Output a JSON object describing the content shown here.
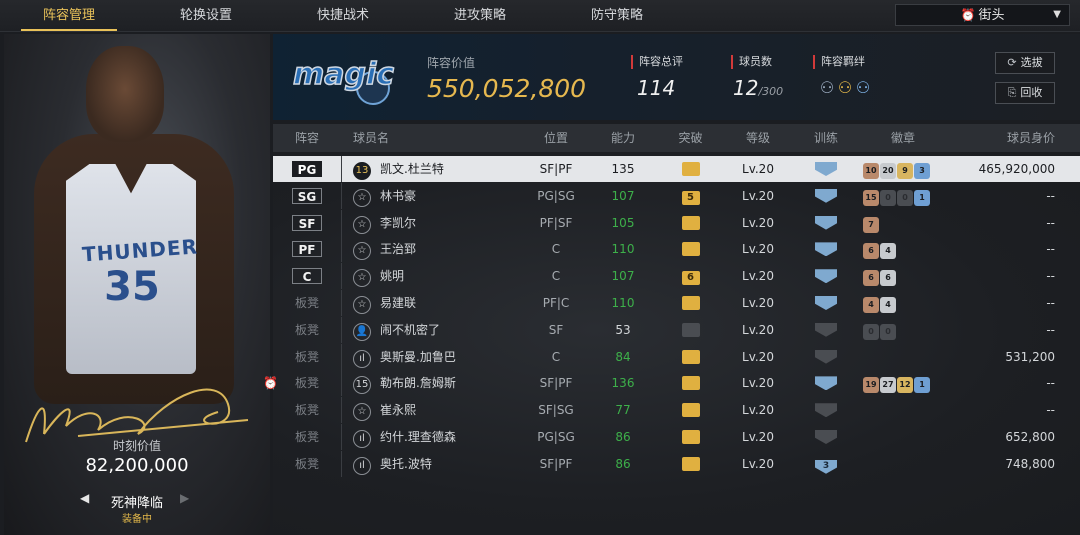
{
  "nav": {
    "tabs": [
      "阵容管理",
      "轮换设置",
      "快捷战术",
      "进攻策略",
      "防守策略"
    ],
    "region": "街头"
  },
  "card": {
    "jersey_text": "THUNDER",
    "jersey_number": "35",
    "value_label": "时刻价值",
    "value": "82,200,000",
    "skill_name": "死神降临",
    "skill_status": "装备中"
  },
  "team": {
    "logo_text": "magic",
    "value_label": "阵容价值",
    "value": "550,052,800",
    "rating_label": "阵容总评",
    "rating": "114",
    "count_label": "球员数",
    "count": "12",
    "count_max": "/300",
    "bond_label": "阵容羁绊",
    "btn_select": "选拔",
    "btn_recycle": "回收"
  },
  "columns": [
    "阵容",
    "球员名",
    "位置",
    "能力",
    "突破",
    "等级",
    "训练",
    "徽章",
    "球员身价"
  ],
  "rows": [
    {
      "slot": "PG",
      "pic": "13",
      "name": "凯文.杜兰特",
      "pos": "SF|PF",
      "ability": "135",
      "breakthrough": "",
      "level": "Lv.20",
      "train": "",
      "badges": [
        [
          "10",
          "bronze"
        ],
        [
          "20",
          "silver"
        ],
        [
          "9",
          "gold"
        ],
        [
          "3",
          "blue"
        ]
      ],
      "price": "465,920,000"
    },
    {
      "slot": "SG",
      "pic": "☆",
      "name": "林书豪",
      "pos": "PG|SG",
      "ability": "107",
      "breakthrough": "5",
      "level": "Lv.20",
      "train": "",
      "badges": [
        [
          "15",
          "bronze"
        ],
        [
          "0",
          "dark"
        ],
        [
          "0",
          "dark"
        ],
        [
          "1",
          "blue"
        ]
      ],
      "price": "--"
    },
    {
      "slot": "SF",
      "pic": "☆",
      "name": "李凯尔",
      "pos": "PF|SF",
      "ability": "105",
      "breakthrough": "",
      "level": "Lv.20",
      "train": "",
      "badges": [
        [
          "7",
          "bronze"
        ]
      ],
      "price": "--"
    },
    {
      "slot": "PF",
      "pic": "☆",
      "name": "王治郅",
      "pos": "C",
      "ability": "110",
      "breakthrough": "",
      "level": "Lv.20",
      "train": "",
      "badges": [
        [
          "6",
          "bronze"
        ],
        [
          "4",
          "silver"
        ]
      ],
      "price": "--"
    },
    {
      "slot": "C",
      "pic": "☆",
      "name": "姚明",
      "pos": "C",
      "ability": "107",
      "breakthrough": "6",
      "level": "Lv.20",
      "train": "",
      "badges": [
        [
          "6",
          "bronze"
        ],
        [
          "6",
          "silver"
        ]
      ],
      "price": "--"
    },
    {
      "slot": "板凳",
      "pic": "☆",
      "name": "易建联",
      "pos": "PF|C",
      "ability": "110",
      "breakthrough": "",
      "level": "Lv.20",
      "train": "",
      "badges": [
        [
          "4",
          "bronze"
        ],
        [
          "4",
          "silver"
        ]
      ],
      "price": "--"
    },
    {
      "slot": "板凳",
      "pic": "👤",
      "name": "闹不机密了",
      "pos": "SF",
      "ability": "53",
      "breakthrough": "",
      "level": "Lv.20",
      "train": "",
      "badges": [
        [
          "0",
          "dark"
        ],
        [
          "0",
          "dark"
        ]
      ],
      "price": "--"
    },
    {
      "slot": "板凳",
      "pic": "ıl",
      "name": "奥斯曼.加鲁巴",
      "pos": "C",
      "ability": "84",
      "breakthrough": "",
      "level": "Lv.20",
      "train": "",
      "badges": [],
      "price": "531,200"
    },
    {
      "slot": "板凳",
      "pic": "15",
      "name": "勒布朗.詹姆斯",
      "pos": "SF|PF",
      "ability": "136",
      "breakthrough": "",
      "level": "Lv.20",
      "train": "",
      "badges": [
        [
          "19",
          "bronze"
        ],
        [
          "27",
          "silver"
        ],
        [
          "12",
          "gold"
        ],
        [
          "1",
          "blue"
        ]
      ],
      "price": "--"
    },
    {
      "slot": "板凳",
      "pic": "☆",
      "name": "崔永熙",
      "pos": "SF|SG",
      "ability": "77",
      "breakthrough": "",
      "level": "Lv.20",
      "train": "",
      "badges": [],
      "price": "--"
    },
    {
      "slot": "板凳",
      "pic": "ıl",
      "name": "约什.理查德森",
      "pos": "PG|SG",
      "ability": "86",
      "breakthrough": "",
      "level": "Lv.20",
      "train": "",
      "badges": [],
      "price": "652,800"
    },
    {
      "slot": "板凳",
      "pic": "ıl",
      "name": "奥托.波特",
      "pos": "SF|PF",
      "ability": "86",
      "breakthrough": "",
      "level": "Lv.20",
      "train": "3",
      "badges": [],
      "price": "748,800"
    }
  ]
}
